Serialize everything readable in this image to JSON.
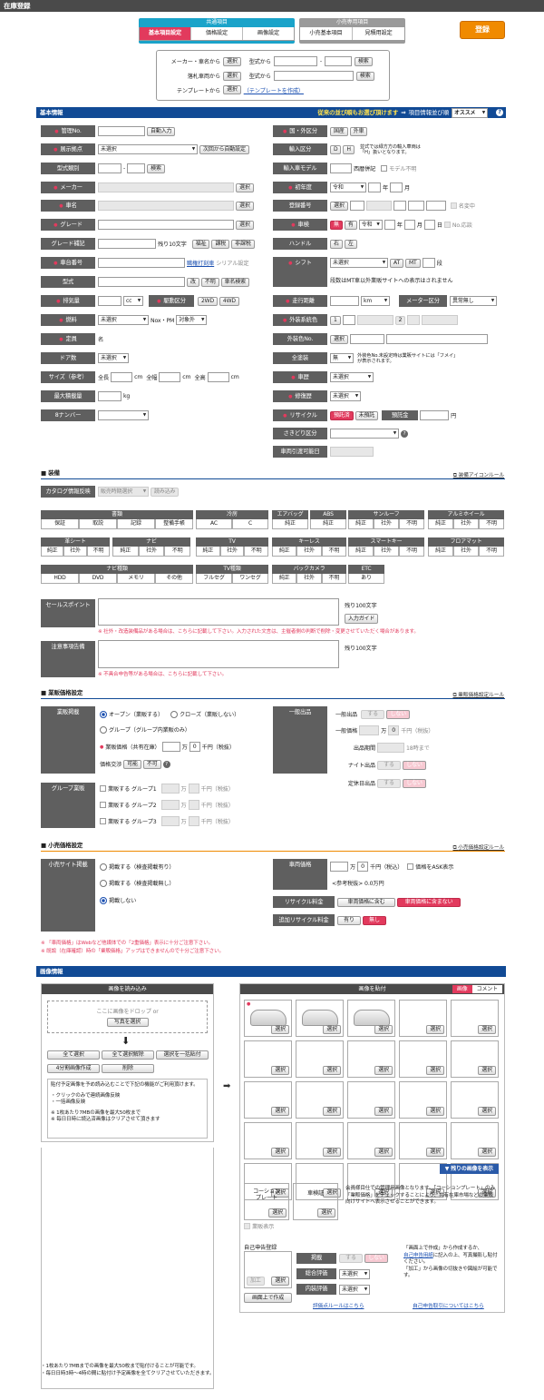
{
  "page_title": "在庫登録",
  "tabs": {
    "common_title": "共通項目",
    "common": [
      "基本項目設定",
      "価格設定",
      "画像設定"
    ],
    "retail_title": "小売専用項目",
    "retail": [
      "小売基本項目",
      "見積用設定"
    ],
    "register": "登録"
  },
  "search": {
    "maker_label": "メーカー・車名から",
    "select": "選択",
    "model_from": "型式から",
    "search_btn": "検索",
    "auction_label": "落札車両から",
    "katashiki_from": "型式から",
    "template_label": "テンプレートから",
    "template_create": "（テンプレートを作成）",
    "dash": "-"
  },
  "basic": {
    "title": "基本情報",
    "note": "従来の並び順もお選び頂けます",
    "arrow": "⇒",
    "order_label": "項目情報並び順",
    "order_value": "オススメ",
    "help": "?"
  },
  "left": {
    "kanri": "管理No.",
    "auto_input": "自動入力",
    "tenji": "展示拠点",
    "unselected": "未選択",
    "next_auto": "次回から自動設定",
    "katashiki_cat": "型式類別",
    "search": "検索",
    "maker": "メーカー",
    "select": "選択",
    "shamei": "車名",
    "grade": "グレード",
    "grade_sup": "グレード補記",
    "remain10": "残り10文字",
    "fukushi": "福祉",
    "kazei": "課税",
    "hikazei": "非課税",
    "shadai": "車台番号",
    "serial_link": "職権打刻車",
    "serial_txt": "シリアル設定",
    "katashiki": "型式",
    "aratame": "改",
    "fumei": "不明",
    "shamei_search": "車名検索",
    "haikiryo": "排気量",
    "cc": "cc",
    "kudo": "駆動区分",
    "d2": "2WD",
    "d4": "4WD",
    "nenryo": "燃料",
    "nox": "Nox・PM",
    "taisho": "対象外",
    "teiin": "定員",
    "mei": "名",
    "door": "ドア数",
    "size": "サイズ（参考）",
    "zencho": "全長",
    "cm": "cm",
    "zenpuku": "全幅",
    "zenko": "全高",
    "saidai": "最大積載量",
    "kg": "kg",
    "number8": "8ナンバー"
  },
  "right": {
    "kuni": "国・外区分",
    "kokusan": "国産",
    "gaisha": "外車",
    "yunyu": "輸入区分",
    "d": "D",
    "h": "H",
    "yunyu_note1": "並式では緑方方の輸入車両は",
    "yunyu_note2": "「H」扱いとなります。",
    "yunyu_model": "輸入車モデル",
    "seireki": "西暦併記",
    "model_fumei": "モデル不明",
    "shonendo": "初年度",
    "reiwa": "令和",
    "nen": "年",
    "tsuki": "月",
    "toroku": "登録番号",
    "select": "選択",
    "meigi": "名変中",
    "shaken": "車検",
    "nashi": "無",
    "ari": "有",
    "nichi": "日",
    "no_taio": "No.応談",
    "handle": "ハンドル",
    "migi": "右",
    "hidari": "左",
    "shift": "シフト",
    "unselected": "未選択",
    "at": "AT",
    "mt": "MT",
    "dan": "段",
    "shift_note": "段数はMT車以外業販サイトへの表示はされません",
    "soko": "走行距離",
    "km": "km",
    "meter": "メーター区分",
    "ijonashi": "異常無し",
    "gaiso": "外装系統色",
    "c1": "1",
    "c2": "2",
    "gaiso_no": "外装色No.",
    "zentoso": "全塗装",
    "zentoso_note1": "外装色No.未設定時は業販サイトには「フメイ」",
    "zentoso_note2": "が表示されます。",
    "shataisho": "車歴",
    "shufuku": "修復歴",
    "recycle": "リサイクル",
    "yotaku": "預託済",
    "miyotaku": "未預託",
    "yotakukin": "預託金",
    "en": "円",
    "sakidori": "さきどり区分",
    "hikiwatashi": "車両引渡可能日"
  },
  "equip": {
    "title": "装備",
    "rule": "装備アイコンルール",
    "catalog": "カタログ情報反映",
    "hanbai": "販売時期選択",
    "yomikomi": "読み込み",
    "groups": [
      {
        "name": "書類",
        "items": [
          "保証",
          "取説",
          "記録",
          "整備手帳"
        ]
      },
      {
        "name": "冷房",
        "items": [
          "AC",
          "C"
        ]
      },
      {
        "name": "エアバッグ",
        "items": [
          "純正"
        ]
      },
      {
        "name": "ABS",
        "items": [
          "純正"
        ]
      },
      {
        "name": "サンルーフ",
        "items": [
          "純正",
          "社外",
          "不明"
        ]
      },
      {
        "name": "アルミホイール",
        "items": [
          "純正",
          "社外",
          "不明"
        ]
      },
      {
        "name": "革シート",
        "items": [
          "純正",
          "社外",
          "不明"
        ]
      },
      {
        "name": "ナビ",
        "items": [
          "純正",
          "社外",
          "不明"
        ]
      },
      {
        "name": "TV",
        "items": [
          "純正",
          "社外",
          "不明"
        ]
      },
      {
        "name": "キーレス",
        "items": [
          "純正",
          "社外",
          "不明"
        ]
      },
      {
        "name": "スマートキー",
        "items": [
          "純正",
          "社外",
          "不明"
        ]
      },
      {
        "name": "フロアマット",
        "items": [
          "純正",
          "社外",
          "不明"
        ]
      },
      {
        "name": "ナビ種類",
        "items": [
          "HDD",
          "DVD",
          "メモリ",
          "その他"
        ]
      },
      {
        "name": "TV種類",
        "items": [
          "フルセグ",
          "ワンセグ"
        ]
      },
      {
        "name": "バックカメラ",
        "items": [
          "純正",
          "社外",
          "不明"
        ]
      },
      {
        "name": "ETC",
        "items": [
          "あり"
        ]
      }
    ]
  },
  "sales": {
    "label": "セールスポイント",
    "remain": "残り100文字",
    "input_guide": "入力ガイド",
    "note": "※ 社外・改造装備品がある場合は、こちらに記載して下さい。入力された文言は、主催者側の判断で削除・変更させていただく場合があります。",
    "caution": "注意事項告備",
    "remain2": "残り100文字",
    "note2": "※ 不具合申告等がある場合は、こちらに記載して下さい。"
  },
  "gyohan": {
    "title": "業販価格設定",
    "rule": "業販価格設定ルール",
    "keisai": "業販掲載",
    "open": "オープン（業販する）",
    "close": "クローズ（業販しない）",
    "group": "グループ（グループ内業販のみ）",
    "price_label": "業販価格（共有在庫）",
    "man": "万",
    "zero": "0",
    "sen": "千円（税抜）",
    "kosho": "価格交渉",
    "kano": "可能",
    "fuka": "不可",
    "help": "?",
    "ippan": "一般出品",
    "suru": "する",
    "shinai": "しない",
    "ippan_price": "一般価格",
    "sen_tax": "千円（税抜）",
    "kikan": "出品期間",
    "made": "18時まで",
    "night": "ナイト出品",
    "teikyu": "定休日出品",
    "group_gyohan": "グループ業販",
    "groups": [
      "業販する グループ1",
      "業販する グループ2",
      "業販する グループ3"
    ]
  },
  "retail": {
    "title": "小売価格設定",
    "rule": "小売価格設定ルール",
    "site": "小売サイト掲載",
    "opt1": "掲載する（検査掲載有り）",
    "opt2": "掲載する（検査掲載無し）",
    "opt3": "掲載しない",
    "price": "車両価格",
    "man": "万",
    "zero": "0",
    "sen": "千円（税込）",
    "ask": "価格をASK表示",
    "sanko": "<参考税抜> 0.0万円",
    "recycle": "リサイクル料金",
    "fukumu": "車両価格に含む",
    "fukumanai": "車両価格に含まない",
    "tsuika": "追加リサイクル料金",
    "ari": "有り",
    "nashi": "無し",
    "note1": "※ 「車両価格」はWebなど他媒体での「2重価格」表示に十分ご注意下さい。",
    "note2": "※ 既設（在庫確認）時の「業販価格」アップはできませんので十分ご注意下さい。"
  },
  "image": {
    "title": "画像情報",
    "load_head": "画像を読み込み",
    "drop": "ここに画像をドロップ or",
    "select_photo": "写真を選択",
    "all_select": "全て選択",
    "all_release": "全て選択解除",
    "bulk": "選択を一括貼付",
    "split": "4分割画像作成",
    "delete": "削除",
    "info1": "貼付予定画像を予め読み込むことで下記の機能がご利用頂けます。",
    "info2": "・クリックのみで連続画像反映",
    "info3": "・一括画像反映",
    "info4": "※ 1枚あたり7MBの画像を最大50枚まで",
    "info5": "※ 毎日日時に読込済画像はクリアさせて頂きます",
    "paste_head": "画像を貼付",
    "tab_img": "画像",
    "tab_comment": "コメント",
    "select": "選択",
    "more": "▼ 残りの画像を表示",
    "coachion": "コーション\nプレート",
    "shakensho": "車検証",
    "coachion_note": "会員様目仕での管理用画像となります。「コーションプレート」のみ「業販価格」をチェックすることにより、共有在庫市場などの業販向けサイトへ表示させることができます。",
    "gyohan_hyoji": "業販表示",
    "jiko": "自己申告登録",
    "kako": "加工",
    "keisai": "掲載",
    "suru": "する",
    "shinai": "しない",
    "sogo": "総合評価",
    "naiso": "内装評価",
    "unselected": "未選択",
    "gamen": "画面上で作成",
    "jiko_note1": "「画面上で作成」から作成するか、",
    "jiko_link": "自己申告用紙",
    "jiko_note2": "に記入の上、写真撮影し貼付ください。",
    "jiko_note3": "「加工」から画像の切抜きや図絵が可能です。",
    "rule_link": "評価点ルールはこちら",
    "koshin_link": "自己申告取引についてはこちら",
    "bottom1": "・1枚あたり7MBまでの画像を最大50枚まで貼付けることが可能です。",
    "bottom2": "・毎日日時3時〜4時の間に貼付け予定画像を全てクリアさせていただきます。"
  },
  "colors": {
    "navy": "#114a95",
    "pink": "#e23a5d",
    "orange": "#f08a00",
    "label_gray": "#5f5f5f"
  }
}
